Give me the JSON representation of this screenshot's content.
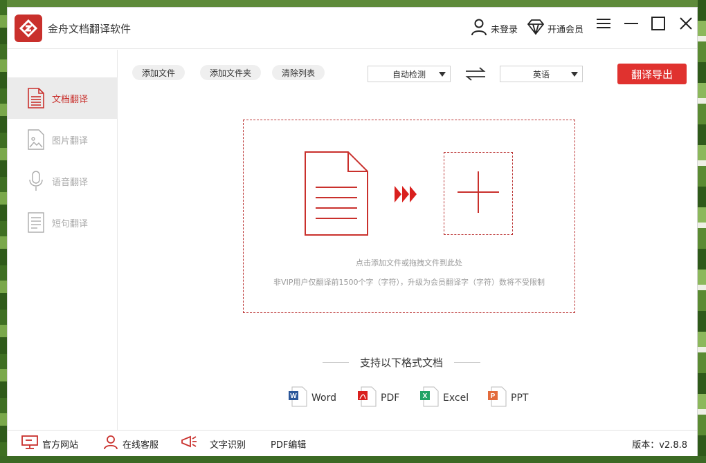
{
  "app": {
    "title": "金舟文档翻译软件"
  },
  "titlebar": {
    "login_label": "未登录",
    "vip_label": "开通会员"
  },
  "sidebar": {
    "items": [
      {
        "label": "文档翻译",
        "icon": "document-icon",
        "active": true
      },
      {
        "label": "图片翻译",
        "icon": "image-icon",
        "active": false
      },
      {
        "label": "语音翻译",
        "icon": "microphone-icon",
        "active": false
      },
      {
        "label": "短句翻译",
        "icon": "text-note-icon",
        "active": false
      }
    ]
  },
  "toolbar": {
    "add_file": "添加文件",
    "add_folder": "添加文件夹",
    "clear_list": "清除列表",
    "source_lang": "自动检测",
    "target_lang": "英语",
    "export_label": "翻译导出"
  },
  "dropzone": {
    "hint_primary": "点击添加文件或拖拽文件到此处",
    "hint_secondary": "非VIP用户仅翻译前1500个字（字符），升级为会员翻译字（字符）数将不受限制"
  },
  "formats": {
    "title": "支持以下格式文档",
    "items": [
      {
        "label": "Word",
        "icon": "word-file-icon",
        "color": "#2b579a"
      },
      {
        "label": "PDF",
        "icon": "pdf-file-icon",
        "color": "#d9201e"
      },
      {
        "label": "Excel",
        "icon": "excel-file-icon",
        "color": "#21a366"
      },
      {
        "label": "PPT",
        "icon": "ppt-file-icon",
        "color": "#e36b3c"
      }
    ]
  },
  "footer": {
    "website": "官方网站",
    "support": "在线客服",
    "ocr": "文字识别",
    "pdf_edit": "PDF编辑",
    "version": "版本：v2.8.8"
  },
  "colors": {
    "accent": "#c9302c",
    "button": "#e0322f"
  }
}
